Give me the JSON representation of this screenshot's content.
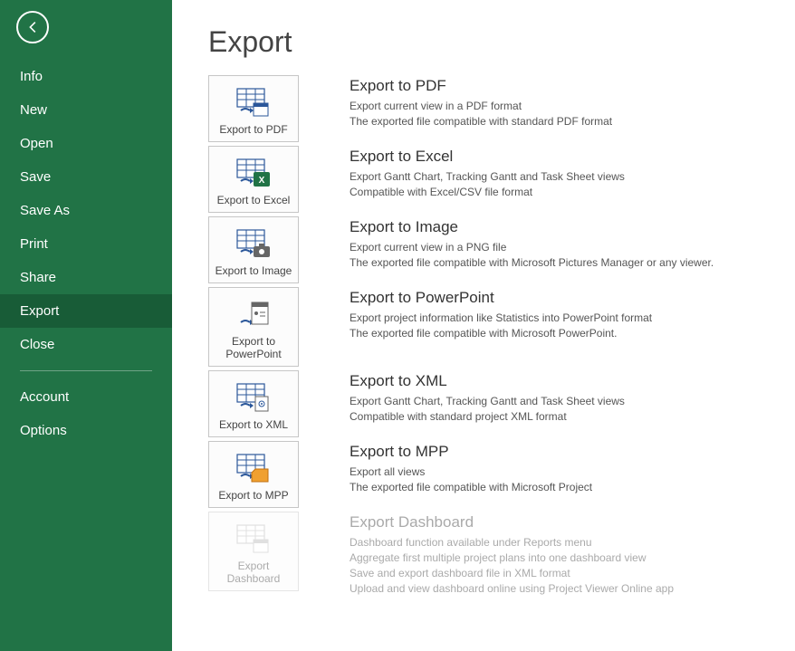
{
  "sidebar": {
    "items": [
      {
        "label": "Info",
        "active": false
      },
      {
        "label": "New",
        "active": false
      },
      {
        "label": "Open",
        "active": false
      },
      {
        "label": "Save",
        "active": false
      },
      {
        "label": "Save As",
        "active": false
      },
      {
        "label": "Print",
        "active": false
      },
      {
        "label": "Share",
        "active": false
      },
      {
        "label": "Export",
        "active": true
      },
      {
        "label": "Close",
        "active": false
      }
    ],
    "footer": [
      {
        "label": "Account"
      },
      {
        "label": "Options"
      }
    ]
  },
  "page": {
    "title": "Export"
  },
  "exports": [
    {
      "id": "pdf",
      "tile_label": "Export to PDF",
      "title": "Export to PDF",
      "lines": [
        "Export current view in a PDF format",
        "The exported file compatible with standard PDF format"
      ],
      "disabled": false
    },
    {
      "id": "excel",
      "tile_label": "Export to Excel",
      "title": "Export to Excel",
      "lines": [
        "Export Gantt Chart, Tracking Gantt and Task Sheet views",
        "Compatible with Excel/CSV file format"
      ],
      "disabled": false
    },
    {
      "id": "image",
      "tile_label": "Export to Image",
      "title": "Export to Image",
      "lines": [
        "Export current view in a PNG file",
        "The exported file compatible with Microsoft Pictures Manager or any viewer."
      ],
      "disabled": false
    },
    {
      "id": "ppt",
      "tile_label": "Export to PowerPoint",
      "title": "Export to PowerPoint",
      "lines": [
        "Export project information like Statistics into PowerPoint format",
        "The exported file compatible with Microsoft PowerPoint."
      ],
      "disabled": false
    },
    {
      "id": "xml",
      "tile_label": "Export to XML",
      "title": "Export to XML",
      "lines": [
        "Export Gantt Chart, Tracking Gantt and Task Sheet views",
        "Compatible with standard project XML format"
      ],
      "disabled": false
    },
    {
      "id": "mpp",
      "tile_label": "Export to MPP",
      "title": "Export to MPP",
      "lines": [
        "Export all views",
        "The exported file compatible with Microsoft Project"
      ],
      "disabled": false
    },
    {
      "id": "dashboard",
      "tile_label": "Export Dashboard",
      "title": "Export Dashboard",
      "lines": [
        "Dashboard function available under Reports menu",
        "Aggregate first multiple project plans into one dashboard view",
        "Save and export dashboard file in XML format",
        "Upload and view dashboard online using Project Viewer Online app"
      ],
      "disabled": true
    }
  ]
}
